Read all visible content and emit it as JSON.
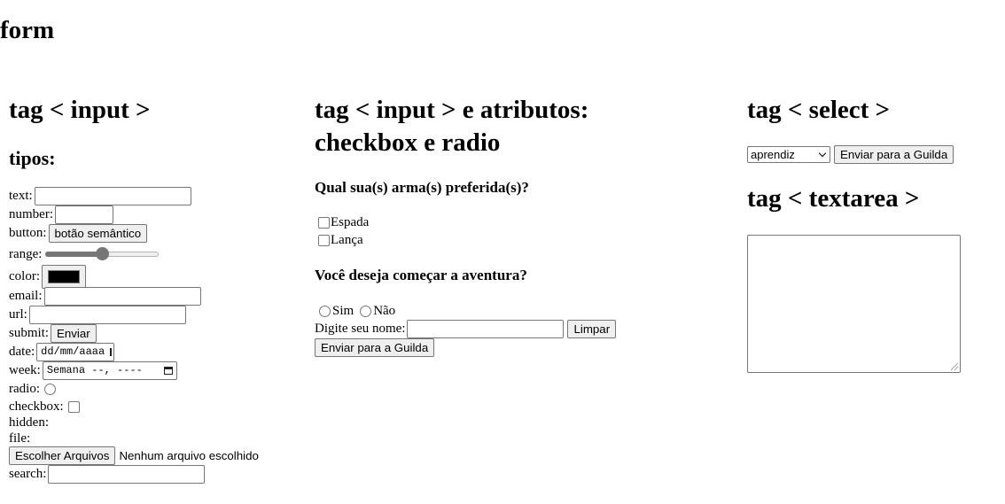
{
  "page": {
    "title": "form"
  },
  "inputs_section": {
    "heading": "tag < input >",
    "subheading": "tipos:",
    "text_label": "text:",
    "number_label": "number:",
    "button_label": "button:",
    "button_text": "botão semântico",
    "range_label": "range:",
    "range_value_fraction": 0.5,
    "color_label": "color:",
    "color_value": "#000000",
    "email_label": "email:",
    "url_label": "url:",
    "submit_label": "submit:",
    "submit_text": "Enviar",
    "date_label": "date:",
    "date_placeholder": "dd/mm/aaaa",
    "week_label": "week:",
    "week_placeholder": "Semana --, ----",
    "radio_label": "radio:",
    "checkbox_label": "checkbox:",
    "hidden_label": "hidden:",
    "file_label": "file:",
    "file_button": "Escolher Arquivos",
    "file_status": "Nenhum arquivo escolhido",
    "search_label": "search:"
  },
  "attrs_section": {
    "heading_line1": "tag < input > e atributos:",
    "heading_line2": "checkbox e radio",
    "weapons_question": "Qual sua(s) arma(s) preferida(s)?",
    "weapon_options": [
      "Espada",
      "Lança"
    ],
    "adventure_question": "Você deseja começar a aventura?",
    "adventure_options": [
      "Sim",
      "Não"
    ],
    "name_label": "Digite seu nome:",
    "reset_button": "Limpar",
    "submit_button": "Enviar para a Guilda"
  },
  "select_section": {
    "heading": "tag < select >",
    "selected_option": "aprendiz",
    "submit_button": "Enviar para a Guilda"
  },
  "textarea_section": {
    "heading": "tag < textarea >"
  }
}
